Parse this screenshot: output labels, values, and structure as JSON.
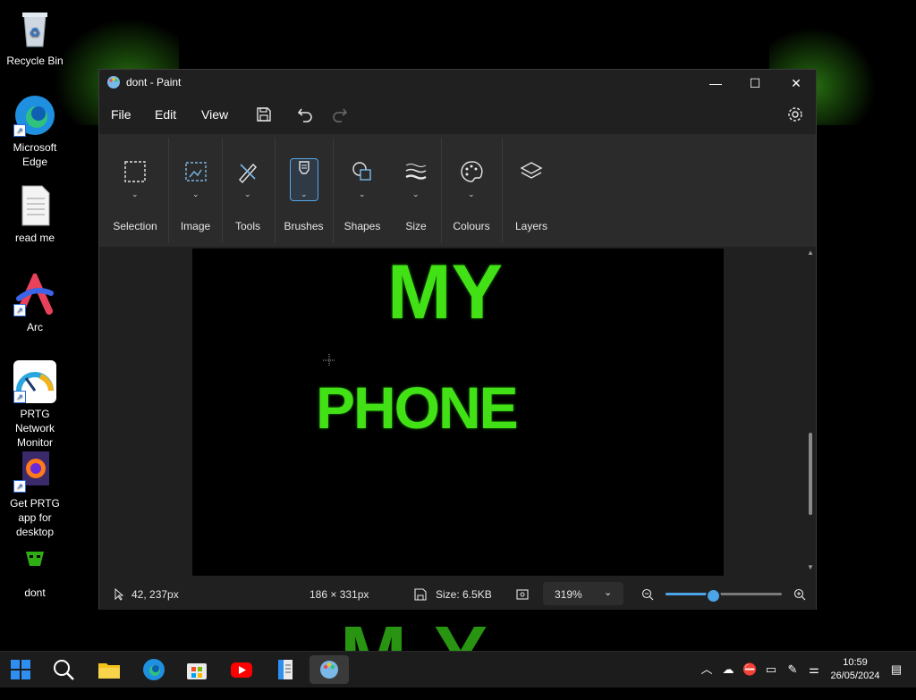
{
  "desktop": {
    "icons": [
      {
        "label": "Recycle Bin"
      },
      {
        "label": "Microsoft Edge"
      },
      {
        "label": "read me"
      },
      {
        "label": "Arc"
      },
      {
        "label": "PRTG Network Monitor"
      },
      {
        "label": "Get PRTG app for desktop"
      },
      {
        "label": "dont"
      }
    ],
    "wallpaper_text": "MY"
  },
  "window": {
    "title": "dont - Paint",
    "controls": {
      "minimize": "—",
      "maximize": "☐",
      "close": "✕"
    }
  },
  "menu": {
    "file": "File",
    "edit": "Edit",
    "view": "View"
  },
  "ribbon": {
    "groups": [
      {
        "label": "Selection"
      },
      {
        "label": "Image"
      },
      {
        "label": "Tools"
      },
      {
        "label": "Brushes"
      },
      {
        "label": "Shapes"
      },
      {
        "label": "Size"
      },
      {
        "label": "Colours"
      },
      {
        "label": "Layers"
      }
    ]
  },
  "canvas": {
    "line1": "MY",
    "line2": "PHONE",
    "accent_color": "#41e115"
  },
  "status": {
    "cursor_pos": "42, 237px",
    "selection_size": "186 × 331px",
    "file_size": "Size: 6.5KB",
    "zoom": "319%",
    "zoom_slider_fraction": 0.4
  },
  "taskbar": {
    "time": "10:59",
    "date": "26/05/2024"
  },
  "colors": {
    "accent": "#4ba3e8",
    "ribbon_bg": "#2b2b2b",
    "window_bg": "#202020"
  }
}
